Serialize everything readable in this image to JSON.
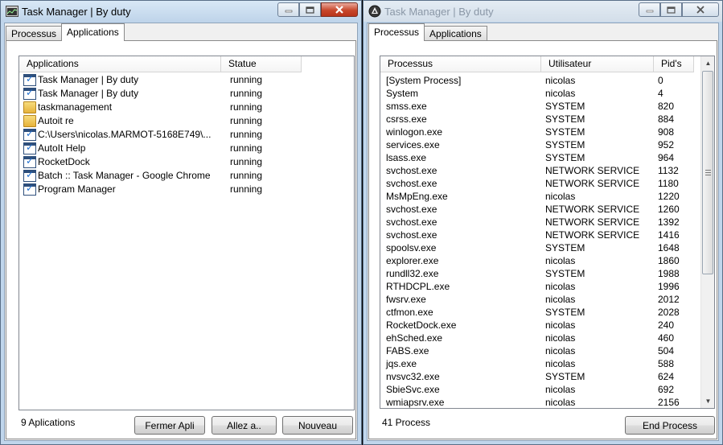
{
  "left_window": {
    "title": "Task Manager | By duty",
    "tabs": [
      {
        "label": "Processus",
        "active": false
      },
      {
        "label": "Applications",
        "active": true
      }
    ],
    "columns": [
      "Applications",
      "Statue"
    ],
    "rows": [
      {
        "name": "Task Manager | By duty",
        "status": "running",
        "icon": "task-window-icon"
      },
      {
        "name": "Task Manager | By duty",
        "status": "running",
        "icon": "task-window-icon"
      },
      {
        "name": "taskmanagement",
        "status": "running",
        "icon": "folder-icon"
      },
      {
        "name": "Autoit re",
        "status": "running",
        "icon": "folder-icon"
      },
      {
        "name": "C:\\Users\\nicolas.MARMOT-5168E749\\...",
        "status": "running",
        "icon": "task-window-icon"
      },
      {
        "name": "AutoIt Help",
        "status": "running",
        "icon": "task-window-icon"
      },
      {
        "name": "RocketDock",
        "status": "running",
        "icon": "task-window-icon"
      },
      {
        "name": "Batch :: Task Manager - Google Chrome",
        "status": "running",
        "icon": "task-window-icon"
      },
      {
        "name": "Program Manager",
        "status": "running",
        "icon": "task-window-icon"
      }
    ],
    "status_text": "9 Aplications",
    "buttons": {
      "close_app": "Fermer Apli",
      "goto": "Allez a..",
      "new": "Nouveau"
    }
  },
  "right_window": {
    "title": "Task Manager | By duty",
    "tabs": [
      {
        "label": "Processus",
        "active": true
      },
      {
        "label": "Applications",
        "active": false
      }
    ],
    "columns": [
      "Processus",
      "Utilisateur",
      "Pid's"
    ],
    "rows": [
      {
        "process": "[System Process]",
        "user": "nicolas",
        "pid": "0"
      },
      {
        "process": "System",
        "user": "nicolas",
        "pid": "4"
      },
      {
        "process": "smss.exe",
        "user": "SYSTEM",
        "pid": "820"
      },
      {
        "process": "csrss.exe",
        "user": "SYSTEM",
        "pid": "884"
      },
      {
        "process": "winlogon.exe",
        "user": "SYSTEM",
        "pid": "908"
      },
      {
        "process": "services.exe",
        "user": "SYSTEM",
        "pid": "952"
      },
      {
        "process": "lsass.exe",
        "user": "SYSTEM",
        "pid": "964"
      },
      {
        "process": "svchost.exe",
        "user": "NETWORK SERVICE",
        "pid": "1132"
      },
      {
        "process": "svchost.exe",
        "user": "NETWORK SERVICE",
        "pid": "1180"
      },
      {
        "process": "MsMpEng.exe",
        "user": "nicolas",
        "pid": "1220"
      },
      {
        "process": "svchost.exe",
        "user": "NETWORK SERVICE",
        "pid": "1260"
      },
      {
        "process": "svchost.exe",
        "user": "NETWORK SERVICE",
        "pid": "1392"
      },
      {
        "process": "svchost.exe",
        "user": "NETWORK SERVICE",
        "pid": "1416"
      },
      {
        "process": "spoolsv.exe",
        "user": "SYSTEM",
        "pid": "1648"
      },
      {
        "process": "explorer.exe",
        "user": "nicolas",
        "pid": "1860"
      },
      {
        "process": "rundll32.exe",
        "user": "SYSTEM",
        "pid": "1988"
      },
      {
        "process": "RTHDCPL.exe",
        "user": "nicolas",
        "pid": "1996"
      },
      {
        "process": "fwsrv.exe",
        "user": "nicolas",
        "pid": "2012"
      },
      {
        "process": "ctfmon.exe",
        "user": "SYSTEM",
        "pid": "2028"
      },
      {
        "process": "RocketDock.exe",
        "user": "nicolas",
        "pid": "240"
      },
      {
        "process": "ehSched.exe",
        "user": "nicolas",
        "pid": "460"
      },
      {
        "process": "FABS.exe",
        "user": "nicolas",
        "pid": "504"
      },
      {
        "process": "jqs.exe",
        "user": "nicolas",
        "pid": "588"
      },
      {
        "process": "nvsvc32.exe",
        "user": "SYSTEM",
        "pid": "624"
      },
      {
        "process": "SbieSvc.exe",
        "user": "nicolas",
        "pid": "692"
      },
      {
        "process": "wmiapsrv.exe",
        "user": "nicolas",
        "pid": "2156"
      }
    ],
    "status_text": "41 Process",
    "buttons": {
      "end_process": "End Process"
    }
  }
}
